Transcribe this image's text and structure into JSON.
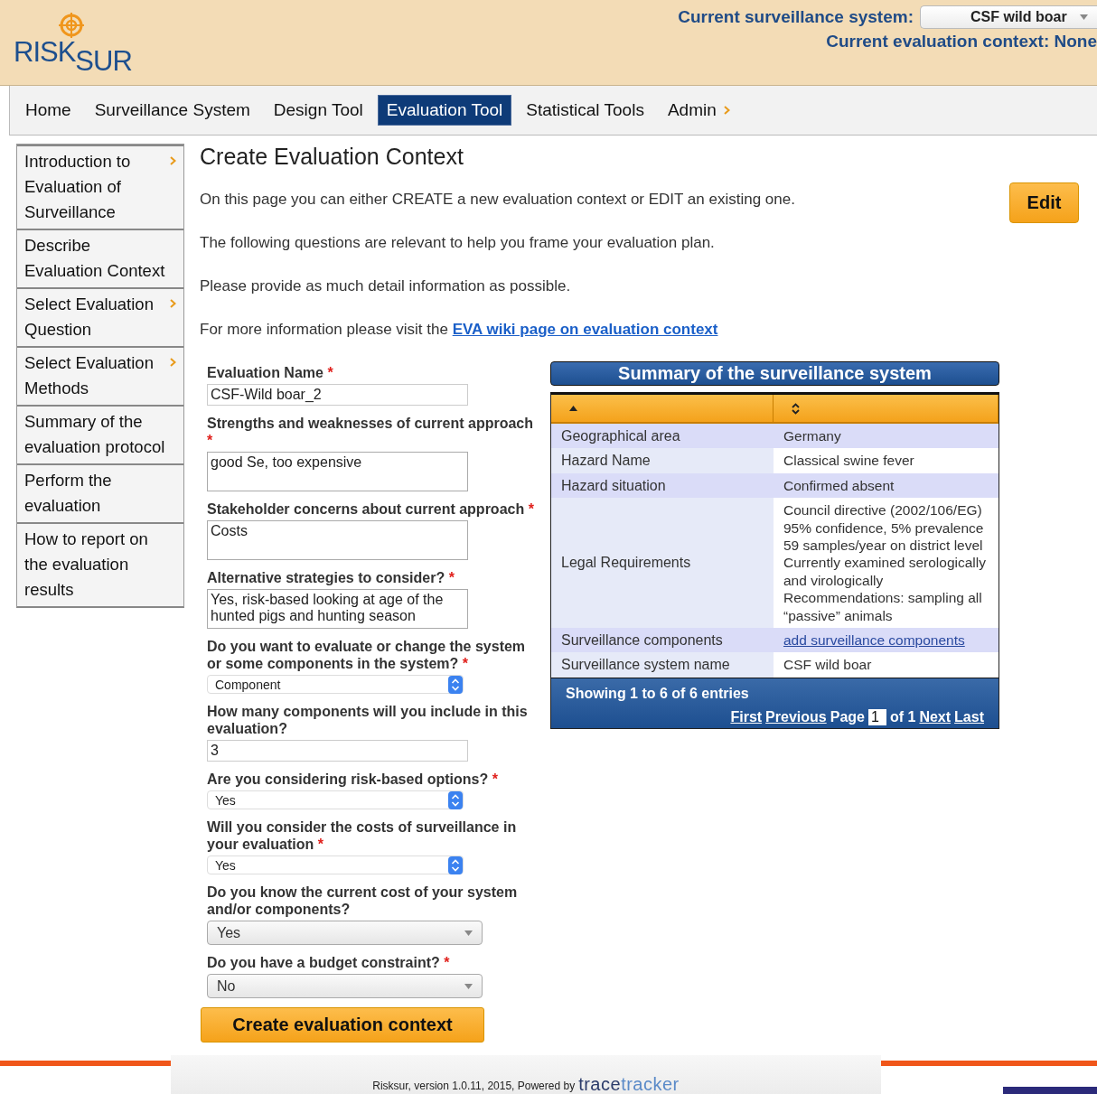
{
  "header": {
    "logo_parts": [
      "RISK",
      "SUR"
    ],
    "system_label": "Current surveillance system:",
    "system_value": "CSF wild boar",
    "context_text": "Current evaluation context: None"
  },
  "nav": [
    {
      "label": "Home",
      "selected": false,
      "has_submenu": false
    },
    {
      "label": "Surveillance System",
      "selected": false,
      "has_submenu": false
    },
    {
      "label": "Design Tool",
      "selected": false,
      "has_submenu": false
    },
    {
      "label": "Evaluation Tool",
      "selected": true,
      "has_submenu": false
    },
    {
      "label": "Statistical Tools",
      "selected": false,
      "has_submenu": false
    },
    {
      "label": "Admin",
      "selected": false,
      "has_submenu": true
    }
  ],
  "sidebar": {
    "items": [
      {
        "label": "Introduction to Evaluation of Surveillance",
        "has_submenu": true
      },
      {
        "label": "Describe Evaluation Context",
        "has_submenu": false
      },
      {
        "label": "Select Evaluation Question",
        "has_submenu": true
      },
      {
        "label": "Select Evaluation Methods",
        "has_submenu": true
      },
      {
        "label": "Summary of the evaluation protocol",
        "has_submenu": false
      },
      {
        "label": "Perform the evaluation",
        "has_submenu": false
      },
      {
        "label": "How to report on the evaluation results",
        "has_submenu": false
      }
    ]
  },
  "main": {
    "title": "Create Evaluation Context",
    "edit_button": "Edit",
    "paragraphs": [
      {
        "text": "On this page you can either CREATE a new evaluation context or EDIT an existing one."
      },
      {
        "text": "The following questions are relevant to help you frame your evaluation plan."
      },
      {
        "text": "Please provide as much detail information as possible."
      },
      {
        "text": "For more information please visit the ",
        "link": "EVA wiki page on evaluation context"
      }
    ]
  },
  "form": {
    "fields": [
      {
        "kind": "text",
        "label": "Evaluation Name",
        "required_mark": "*",
        "value": "CSF-Wild boar_2"
      },
      {
        "kind": "textarea",
        "label": "Strengths and weaknesses of current approach",
        "required_mark": "*",
        "value": "good Se, too expensive"
      },
      {
        "kind": "textarea",
        "label": "Stakeholder concerns about current approach",
        "required_mark": "*",
        "value": "Costs"
      },
      {
        "kind": "textarea",
        "label": "Alternative strategies to consider?",
        "required_mark": "*",
        "value": "Yes, risk-based looking at age of the hunted pigs and hunting season"
      },
      {
        "kind": "stepper",
        "label": "Do you want to evaluate or change the system or some components in the system?",
        "required_mark": "*",
        "value": "Component"
      },
      {
        "kind": "text",
        "label": "How many components will you include in this evaluation?",
        "value": "3"
      },
      {
        "kind": "stepper",
        "label": "Are you considering risk-based options?",
        "required_mark": "*",
        "value": "Yes"
      },
      {
        "kind": "stepper",
        "label": "Will you consider the costs of surveillance in your evaluation",
        "required_mark": "*",
        "value": "Yes"
      },
      {
        "kind": "dropdown",
        "label": "Do you know the current cost of your system and/or components?",
        "value": "Yes"
      },
      {
        "kind": "dropdown",
        "label": "Do you have a budget constraint?",
        "required_mark": "*",
        "value": "No"
      }
    ],
    "submit": "Create evaluation context"
  },
  "summary": {
    "title": "Summary of the surveillance system",
    "columns": [
      {
        "sorted": true
      },
      {
        "sorted": false
      }
    ],
    "rows": [
      {
        "label": "Geographical area",
        "value": "Germany",
        "kind": "text"
      },
      {
        "label": "Hazard Name",
        "value": "Classical swine fever",
        "kind": "text"
      },
      {
        "label": "Hazard situation",
        "value": "Confirmed absent",
        "kind": "text"
      },
      {
        "label": "Legal Requirements",
        "value": "Council directive (2002/106/EG) 95% confidence, 5% prevalence 59 samples/year on district level Currently examined serologically and virologically Recommendations: sampling all “passive” animals",
        "kind": "text"
      },
      {
        "label": "Surveillance components",
        "value": "add surveillance components",
        "kind": "link"
      },
      {
        "label": "Surveillance system name",
        "value": "CSF wild boar",
        "kind": "text"
      }
    ],
    "info": "Showing 1 to 6 of 6 entries",
    "pager": {
      "first": "First",
      "previous": "Previous",
      "page_label": "Page",
      "page": "1",
      "of": "of 1",
      "next": "Next",
      "last": "Last"
    }
  },
  "footer": {
    "text": "Risksur, version 1.0.11, 2015, Powered by",
    "brand_parts": [
      "trace",
      "tracker"
    ]
  }
}
